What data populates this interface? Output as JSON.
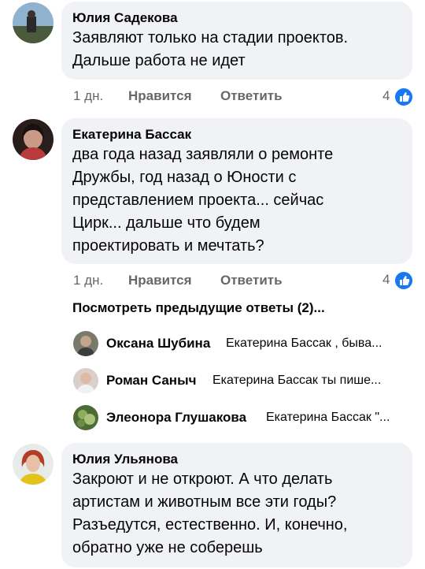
{
  "comments": [
    {
      "author": "Юлия Садекова",
      "lines": [
        "Заявляют только на стадии проектов.",
        "Дальше работа не идет"
      ],
      "time": "1 дн.",
      "like_label": "Нравится",
      "reply_label": "Ответить",
      "reactions": "4",
      "reaction_icon": "thumbs-up-icon"
    },
    {
      "author": "Екатерина Бассак",
      "lines": [
        "два года назад заявляли о ремонте",
        "Дружбы, год назад о Юности с",
        "представлением проекта... сейчас",
        "Цирк... дальше что будем",
        "проектировать и мечтать?"
      ],
      "time": "1 дн.",
      "like_label": "Нравится",
      "reply_label": "Ответить",
      "reactions": "4",
      "reaction_icon": "thumbs-up-icon"
    },
    {
      "author": "Юлия Ульянова",
      "lines": [
        "Закроют и не откроют. А что делать",
        "артистам и животным все эти годы?",
        "Разъедутся, естественно. И, конечно,",
        "обратно уже не соберешь"
      ]
    }
  ],
  "more_replies": "Посмотреть предыдущие ответы (2)...",
  "replies": [
    {
      "author": "Оксана Шубина",
      "preview": "Екатерина Бассак , быва..."
    },
    {
      "author": "Роман Саныч",
      "preview": "Екатерина Бассак ты пише..."
    },
    {
      "author": "Элеонора Глушакова",
      "preview": "Екатерина Бассак \"..."
    }
  ],
  "colors": {
    "bubble": "#f0f2f5",
    "meta": "#65676b",
    "like_badge": "#1877f2"
  }
}
